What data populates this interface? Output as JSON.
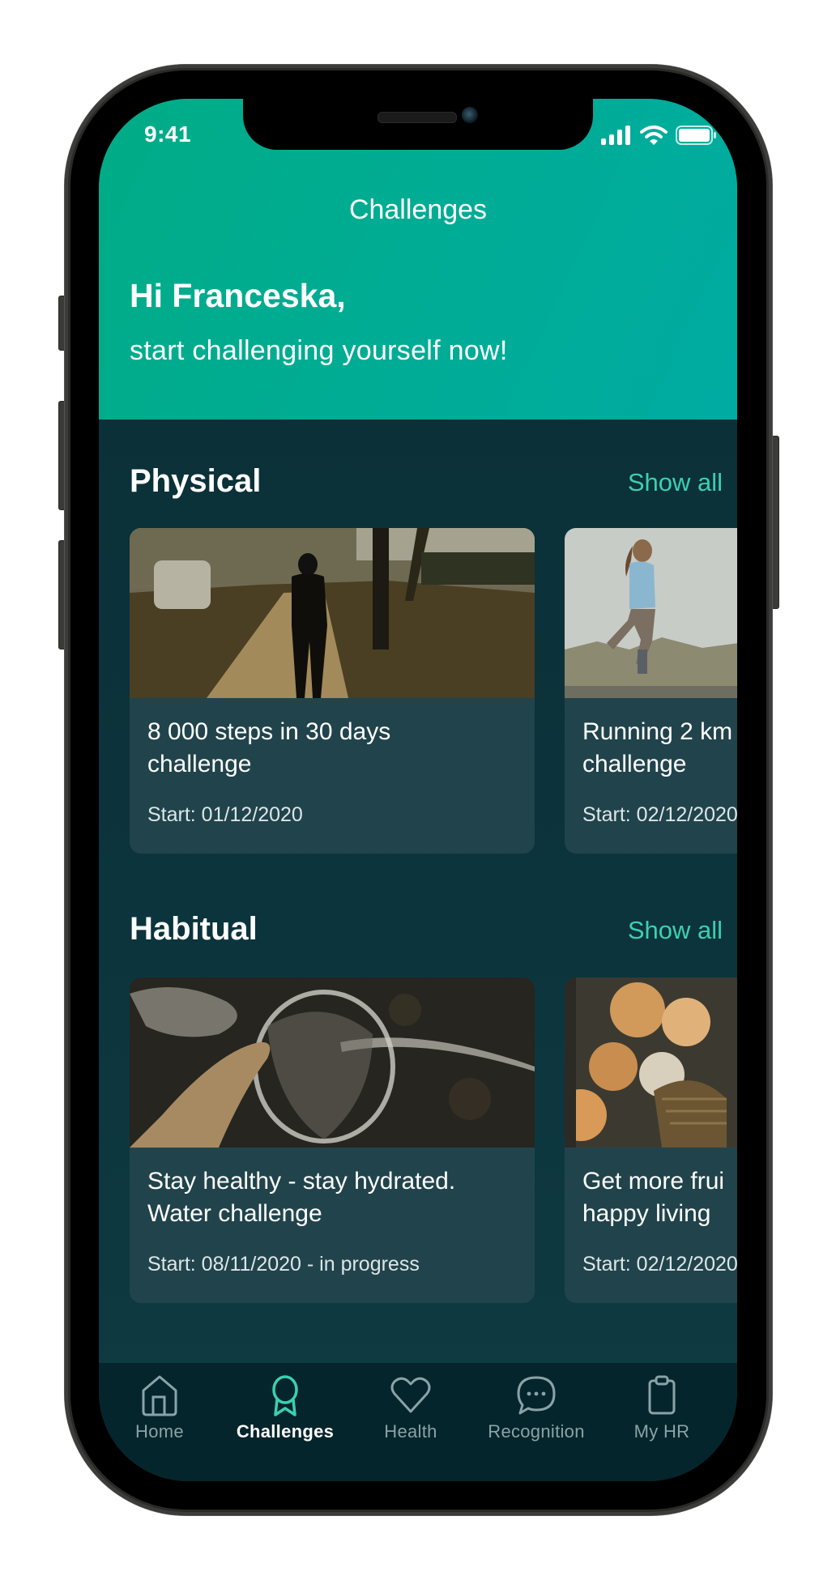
{
  "status_bar": {
    "time": "9:41",
    "icons": [
      "cellular-signal-icon",
      "wifi-icon",
      "battery-icon"
    ]
  },
  "header": {
    "title": "Challenges",
    "greeting": "Hi Franceska,",
    "subtitle": "start challenging yourself now!"
  },
  "sections": [
    {
      "title": "Physical",
      "show_all_label": "Show all",
      "cards": [
        {
          "title": "8 000 steps in 30 days\nchallenge",
          "date": "Start: 01/12/2020",
          "image": "person walking on sidewalk at sunset"
        },
        {
          "title": "Running 2 km\nchallenge",
          "date": "Start: 02/12/2020",
          "image": "woman jogging outdoors"
        }
      ]
    },
    {
      "title": "Habitual",
      "show_all_label": "Show all",
      "cards": [
        {
          "title": "Stay healthy - stay hydrated.\nWater challenge",
          "date": "Start: 08/11/2020 - in progress",
          "image": "water splashing into a glass"
        },
        {
          "title": "Get more frui\nhappy living",
          "date": "Start: 02/12/2020",
          "image": "fruit baskets at a market"
        }
      ]
    }
  ],
  "tabbar": {
    "active": "Challenges",
    "items": [
      {
        "label": "Home",
        "icon": "home-icon"
      },
      {
        "label": "Challenges",
        "icon": "award-ribbon-icon"
      },
      {
        "label": "Health",
        "icon": "heart-icon"
      },
      {
        "label": "Recognition",
        "icon": "chat-bubble-icon"
      },
      {
        "label": "My HR",
        "icon": "clipboard-icon"
      }
    ]
  },
  "colors": {
    "header_gradient_start": "#00ac86",
    "header_gradient_end": "#00aba2",
    "background": "#0c343c",
    "card": "#21444c",
    "accent": "#3ccfb0",
    "tabbar": "#04252b",
    "tab_inactive": "#8aa3a8"
  }
}
